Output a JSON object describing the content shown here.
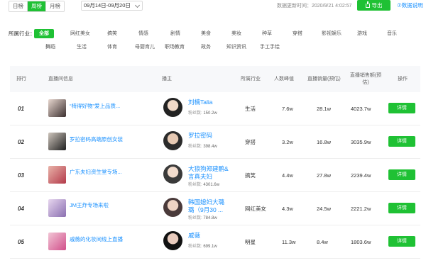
{
  "top": {
    "tabs": [
      "日榜",
      "周榜",
      "月榜"
    ],
    "active_tab": 1,
    "date_range": "09月14日-09月20日",
    "update_time": "数据更新时间：2020/9/21 4:02:57",
    "export_label": "导出",
    "help_label": "⑦数据说明"
  },
  "filter": {
    "label": "所属行业：",
    "tags": [
      "全部",
      "网红美女",
      "搞笑",
      "情感",
      "剧情",
      "美食",
      "美妆",
      "种草",
      "穿搭",
      "影视娱乐",
      "游戏",
      "音乐",
      "舞蹈",
      "生活",
      "体育",
      "母婴育儿",
      "职场教育",
      "政务",
      "知识资讯",
      "手工手绘"
    ],
    "active": 0
  },
  "table": {
    "headers": {
      "rank": "排行",
      "room": "直播间信息",
      "anchor": "播主",
      "industry": "所属行业",
      "peak": "人数峰值",
      "sales_volume": "直播销量(预估)",
      "sales_amount_1": "直播销售额(预",
      "sales_amount_2": "估)",
      "action": "操作"
    },
    "fans_label": "粉丝数:",
    "detail_label": "详情",
    "rows": [
      {
        "rank": "01",
        "room": "“椅得好物”爱上品质...",
        "anchor_1": "刘楠Talia",
        "anchor_2": "",
        "fans": "150.2w",
        "industry": "生活",
        "peak": "7.6w",
        "volume": "28.1w",
        "amount": "4023.7w"
      },
      {
        "rank": "02",
        "room": "罗拉密码高端原创女装",
        "anchor_1": "罗拉密码",
        "anchor_2": "",
        "fans": "398.4w",
        "industry": "穿搭",
        "peak": "3.2w",
        "volume": "16.8w",
        "amount": "3035.9w"
      },
      {
        "rank": "03",
        "room": "广东夫妇资生堂专场...",
        "anchor_1": "大狼狗郑建鹏&",
        "anchor_2": "言真夫妇",
        "fans": "4301.6w",
        "industry": "搞笑",
        "peak": "4.4w",
        "volume": "27.8w",
        "amount": "2239.4w"
      },
      {
        "rank": "04",
        "room": "JM王炸专场来啦",
        "anchor_1": "韩国媳妇大璐",
        "anchor_2": "璐（9月30 ...",
        "fans": "784.8w",
        "industry": "网红美女",
        "peak": "4.3w",
        "volume": "24.5w",
        "amount": "2221.2w"
      },
      {
        "rank": "05",
        "room": "戚薇的化妆间线上直播",
        "anchor_1": "戚薇",
        "anchor_2": "",
        "fans": "699.1w",
        "industry": "明星",
        "peak": "11.3w",
        "volume": "8.4w",
        "amount": "1803.6w"
      }
    ]
  },
  "colors": {
    "accent": "#1fc134",
    "link": "#1890ff"
  }
}
